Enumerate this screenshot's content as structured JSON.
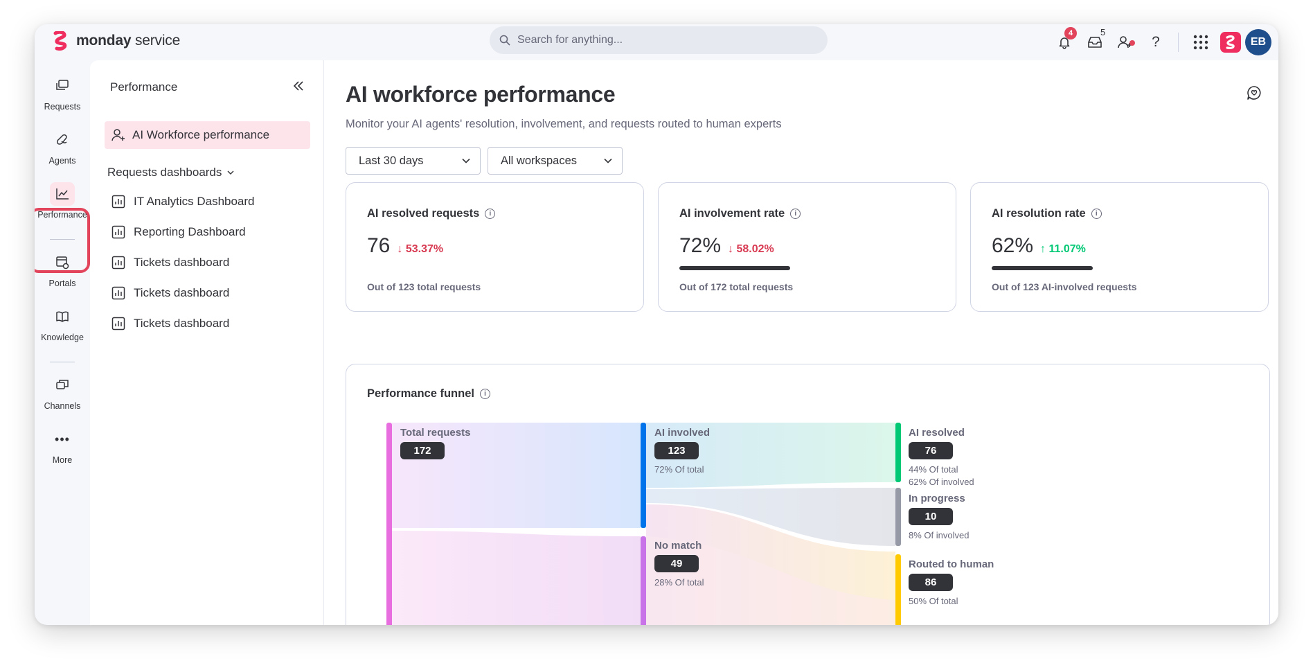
{
  "app": {
    "brand_bold": "monday",
    "brand_light": " service"
  },
  "search": {
    "placeholder": "Search for anything..."
  },
  "topbar": {
    "notifications_count": "4",
    "inbox_count": "5",
    "help": "?",
    "avatar_initials": "EB"
  },
  "rail": {
    "items": [
      {
        "label": "Requests",
        "icon": "requests-icon"
      },
      {
        "label": "Agents",
        "icon": "agents-icon"
      },
      {
        "label": "Performance",
        "icon": "chart-icon",
        "active": true
      },
      {
        "label": "Portals",
        "icon": "portals-icon"
      },
      {
        "label": "Knowledge",
        "icon": "book-icon"
      },
      {
        "label": "Channels",
        "icon": "channels-icon"
      },
      {
        "label": "More",
        "icon": "more-icon"
      }
    ]
  },
  "sidebar": {
    "title": "Performance",
    "active_item": "AI Workforce performance",
    "group_label": "Requests dashboards",
    "items": [
      "IT Analytics Dashboard",
      "Reporting Dashboard",
      "Tickets dashboard",
      "Tickets dashboard",
      "Tickets dashboard"
    ]
  },
  "main": {
    "title": "AI workforce performance",
    "subtitle": "Monitor your AI agents' resolution, involvement, and requests routed to human experts",
    "filters": {
      "range": "Last 30 days",
      "workspace": "All workspaces"
    }
  },
  "cards": [
    {
      "title": "AI resolved requests",
      "value": "76",
      "delta": "↓ 53.37%",
      "direction": "down",
      "footer": "Out of 123 total requests",
      "bar": false
    },
    {
      "title": "AI involvement rate",
      "value": "72%",
      "delta": "↓ 58.02%",
      "direction": "down",
      "footer": "Out of 172 total requests",
      "bar": true
    },
    {
      "title": "AI resolution rate",
      "value": "62%",
      "delta": "↑ 11.07%",
      "direction": "up",
      "footer": "Out of 123 AI-involved requests",
      "bar": true
    }
  ],
  "funnel": {
    "title": "Performance funnel",
    "nodes": {
      "total": {
        "label": "Total requests",
        "value": "172"
      },
      "involved": {
        "label": "AI involved",
        "value": "123",
        "note1": "72% Of total"
      },
      "nomatch": {
        "label": "No match",
        "value": "49",
        "note1": "28% Of total"
      },
      "resolved": {
        "label": "AI resolved",
        "value": "76",
        "note1": "44% Of total",
        "note2": "62% Of involved"
      },
      "progress": {
        "label": "In progress",
        "value": "10",
        "note1": "8% Of involved"
      },
      "routed": {
        "label": "Routed to human",
        "value": "86",
        "note1": "50% Of total"
      }
    },
    "colors": {
      "total": "#e86ee0",
      "involved": "#0073ea",
      "nomatch": "#c874e8",
      "resolved": "#00c875",
      "progress": "#9699a6",
      "routed": "#ffcb00"
    }
  }
}
